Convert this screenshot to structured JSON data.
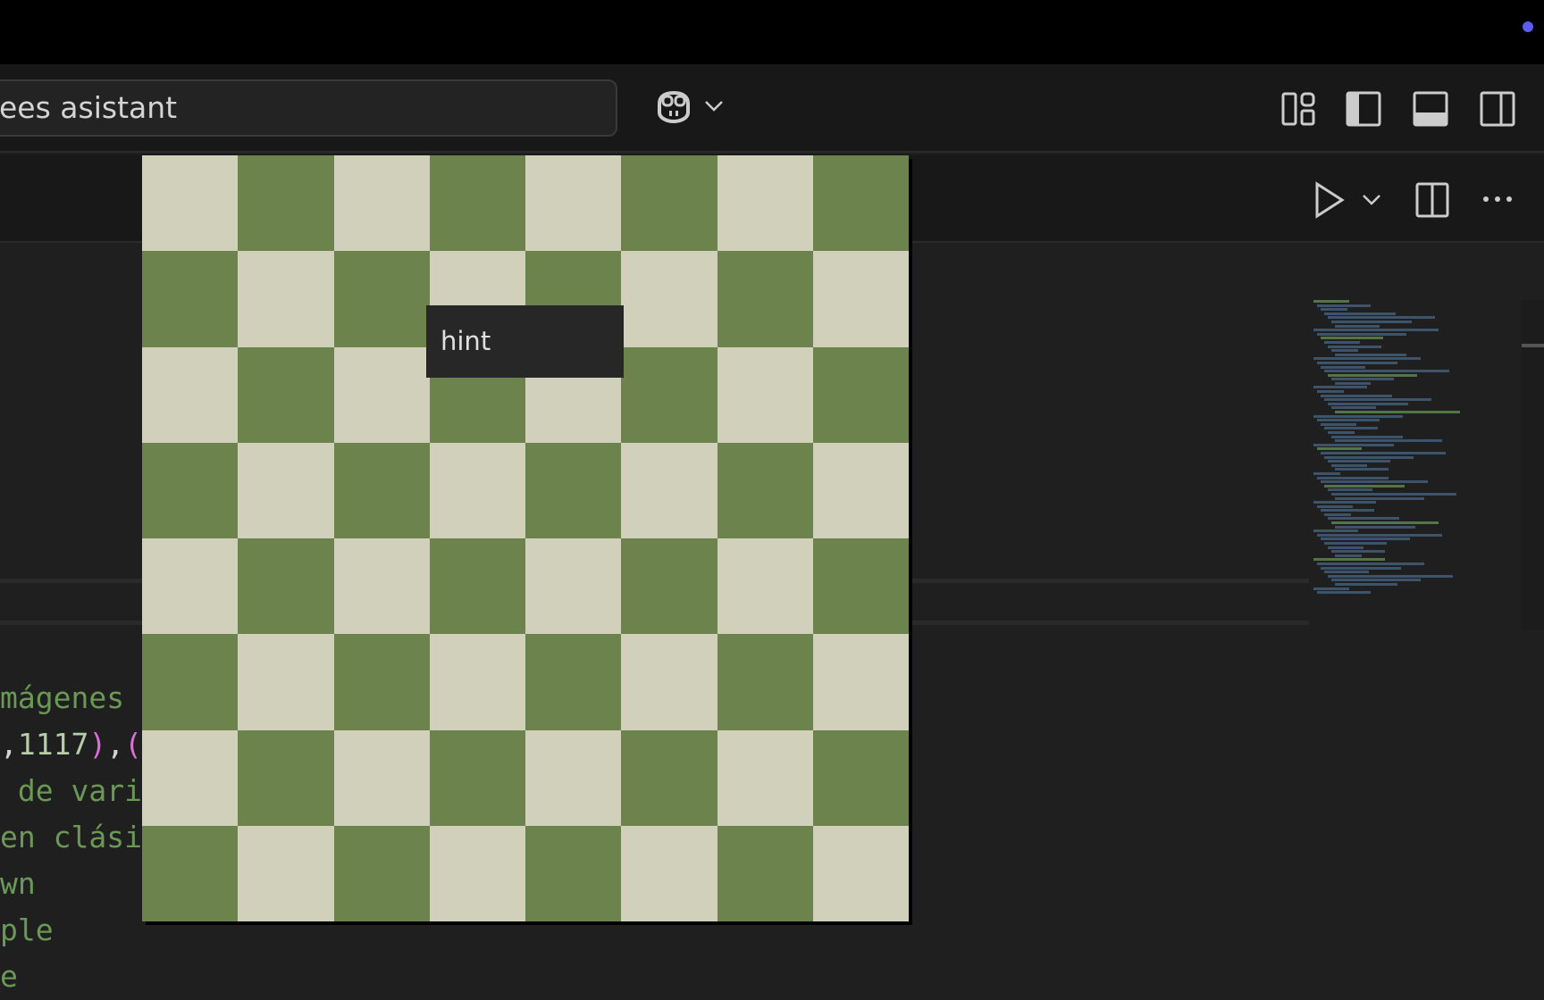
{
  "titlebar": {
    "search_text": "ees asistant"
  },
  "icons": [
    "copilot-icon",
    "chevron-down-icon",
    "customize-layout-icon",
    "toggle-primary-sidebar-icon",
    "toggle-panel-icon",
    "toggle-secondary-sidebar-icon",
    "run-icon",
    "split-editor-icon",
    "more-actions-icon"
  ],
  "editor": {
    "code_lines": [
      [
        {
          "t": "mágenes",
          "c": "g"
        }
      ],
      [
        {
          "t": ",",
          "c": "w"
        },
        {
          "t": "1117",
          "c": "n"
        },
        {
          "t": ")",
          "c": "p"
        },
        {
          "t": ",",
          "c": "w"
        },
        {
          "t": "(",
          "c": "p"
        }
      ],
      [
        {
          "t": " de vari",
          "c": "g"
        }
      ],
      [
        {
          "t": "en clási",
          "c": "g"
        }
      ],
      [
        {
          "t": "wn",
          "c": "g"
        }
      ],
      [
        {
          "t": "ple",
          "c": "g"
        }
      ],
      [
        {
          "t": "e",
          "c": "g"
        }
      ]
    ]
  },
  "preview": {
    "board_size": 8,
    "light_color": "#d0d0bb",
    "dark_color": "#6c834d",
    "tooltip": "hint"
  },
  "colors": {
    "accent_dot": "#5b5bf0"
  }
}
